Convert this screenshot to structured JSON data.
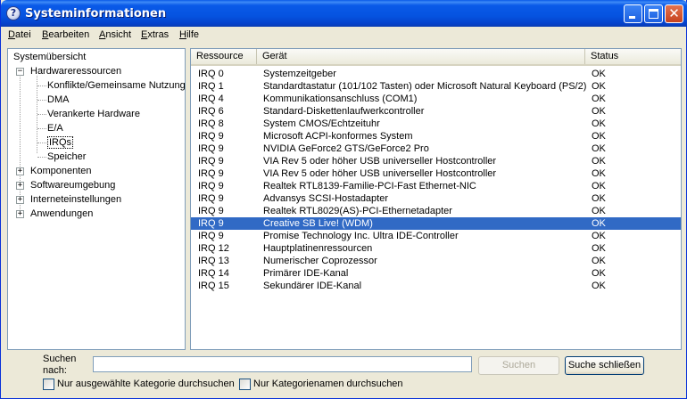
{
  "window": {
    "title": "Systeminformationen",
    "icon": "help-question-icon",
    "controls": {
      "minimize": "minimize-icon",
      "maximize": "maximize-icon",
      "close": "close-icon",
      "close_glyph": "✕"
    }
  },
  "menu": [
    {
      "label": "Datei",
      "ul": "D",
      "rest": "atei"
    },
    {
      "label": "Bearbeiten",
      "ul": "B",
      "rest": "earbeiten"
    },
    {
      "label": "Ansicht",
      "ul": "A",
      "rest": "nsicht"
    },
    {
      "label": "Extras",
      "ul": "E",
      "rest": "xtras"
    },
    {
      "label": "Hilfe",
      "ul": "H",
      "rest": "ilfe"
    }
  ],
  "tree": {
    "root": "Systemübersicht",
    "hardware": "Hardwareressourcen",
    "hardware_children": [
      "Konflikte/Gemeinsame Nutzung",
      "DMA",
      "Verankerte Hardware",
      "E/A",
      "IRQs",
      "Speicher"
    ],
    "selected": "IRQs",
    "others": [
      "Komponenten",
      "Softwareumgebung",
      "Interneteinstellungen",
      "Anwendungen"
    ],
    "expanded_glyph": "−",
    "collapsed_glyph": "+"
  },
  "table": {
    "columns": [
      "Ressource",
      "Gerät",
      "Status"
    ],
    "rows": [
      [
        "IRQ 0",
        "Systemzeitgeber",
        "OK"
      ],
      [
        "IRQ 1",
        "Standardtastatur (101/102 Tasten) oder Microsoft Natural Keyboard (PS/2)",
        "OK"
      ],
      [
        "IRQ 4",
        "Kommunikationsanschluss (COM1)",
        "OK"
      ],
      [
        "IRQ 6",
        "Standard-Diskettenlaufwerkcontroller",
        "OK"
      ],
      [
        "IRQ 8",
        "System CMOS/Echtzeituhr",
        "OK"
      ],
      [
        "IRQ 9",
        "Microsoft ACPI-konformes System",
        "OK"
      ],
      [
        "IRQ 9",
        "NVIDIA GeForce2 GTS/GeForce2 Pro",
        "OK"
      ],
      [
        "IRQ 9",
        "VIA Rev 5 oder höher USB universeller Hostcontroller",
        "OK"
      ],
      [
        "IRQ 9",
        "VIA Rev 5 oder höher USB universeller Hostcontroller",
        "OK"
      ],
      [
        "IRQ 9",
        "Realtek RTL8139-Familie-PCI-Fast Ethernet-NIC",
        "OK"
      ],
      [
        "IRQ 9",
        "Advansys SCSI-Hostadapter",
        "OK"
      ],
      [
        "IRQ 9",
        "Realtek RTL8029(AS)-PCI-Ethernetadapter",
        "OK"
      ],
      [
        "IRQ 9",
        "Creative SB Live! (WDM)",
        "OK"
      ],
      [
        "IRQ 9",
        "Promise Technology Inc. Ultra IDE-Controller",
        "OK"
      ],
      [
        "IRQ 12",
        "Hauptplatinenressourcen",
        "OK"
      ],
      [
        "IRQ 13",
        "Numerischer Coprozessor",
        "OK"
      ],
      [
        "IRQ 14",
        "Primärer IDE-Kanal",
        "OK"
      ],
      [
        "IRQ 15",
        "Sekundärer IDE-Kanal",
        "OK"
      ]
    ],
    "selected_row": 12
  },
  "search": {
    "label_line1": "Suchen",
    "label_line2": "nach:",
    "value": "",
    "search_button": "Suchen",
    "close_button": "Suche schließen",
    "checkbox1": "Nur ausgewählte Kategorie durchsuchen",
    "checkbox2": "Nur Kategorienamen durchsuchen"
  }
}
